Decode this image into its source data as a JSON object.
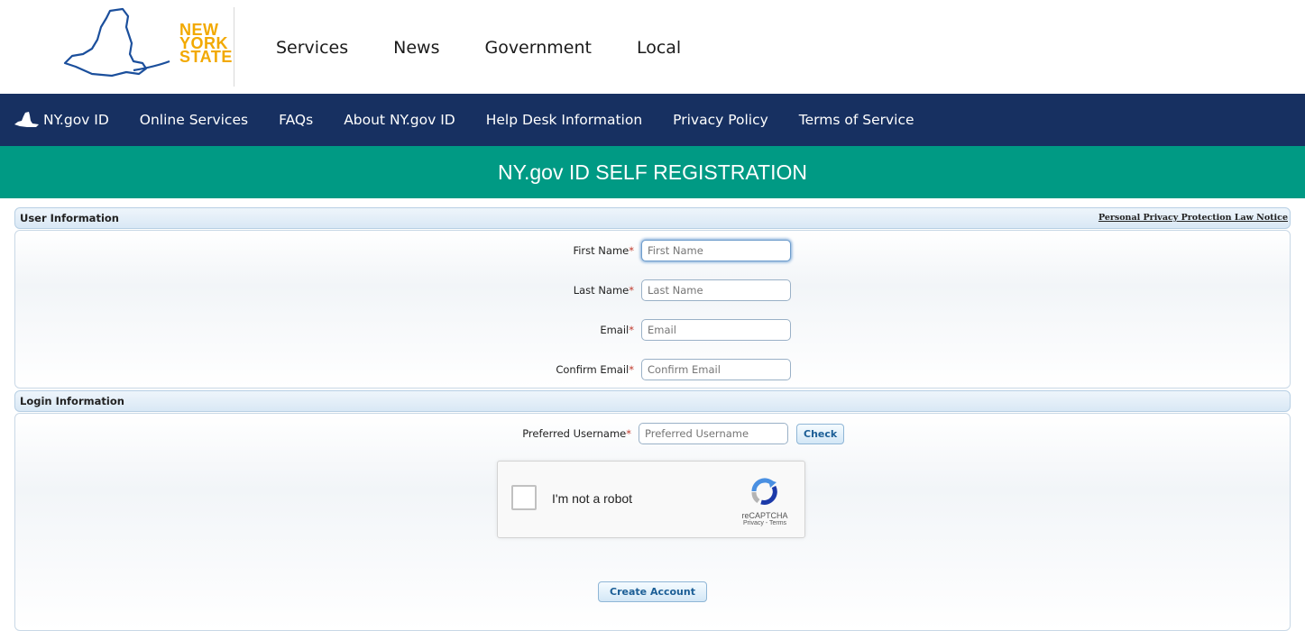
{
  "header": {
    "logo_lines": [
      "NEW",
      "YORK",
      "STATE"
    ],
    "nav": [
      "Services",
      "News",
      "Government",
      "Local"
    ]
  },
  "bluenav": {
    "brand": "NY.gov ID",
    "items": [
      "Online Services",
      "FAQs",
      "About NY.gov ID",
      "Help Desk Information",
      "Privacy Policy",
      "Terms of Service"
    ]
  },
  "banner": {
    "title": "NY.gov ID SELF REGISTRATION"
  },
  "user_section": {
    "title": "User Information",
    "notice": "Personal Privacy Protection Law Notice",
    "fields": [
      {
        "label": "First Name",
        "placeholder": "First Name"
      },
      {
        "label": "Last Name",
        "placeholder": "Last Name"
      },
      {
        "label": "Email",
        "placeholder": "Email"
      },
      {
        "label": "Confirm Email",
        "placeholder": "Confirm Email"
      }
    ]
  },
  "login_section": {
    "title": "Login Information",
    "username_label": "Preferred Username",
    "username_placeholder": "Preferred Username",
    "check_label": "Check",
    "captcha": {
      "label": "I'm not a robot",
      "brand": "reCAPTCHA",
      "links": "Privacy - Terms"
    },
    "create_label": "Create Account"
  },
  "required_marker": "*",
  "colors": {
    "nav_blue": "#173061",
    "banner_teal": "#009a84",
    "logo_gold": "#f2a900",
    "logo_outline": "#1b4f9c"
  }
}
